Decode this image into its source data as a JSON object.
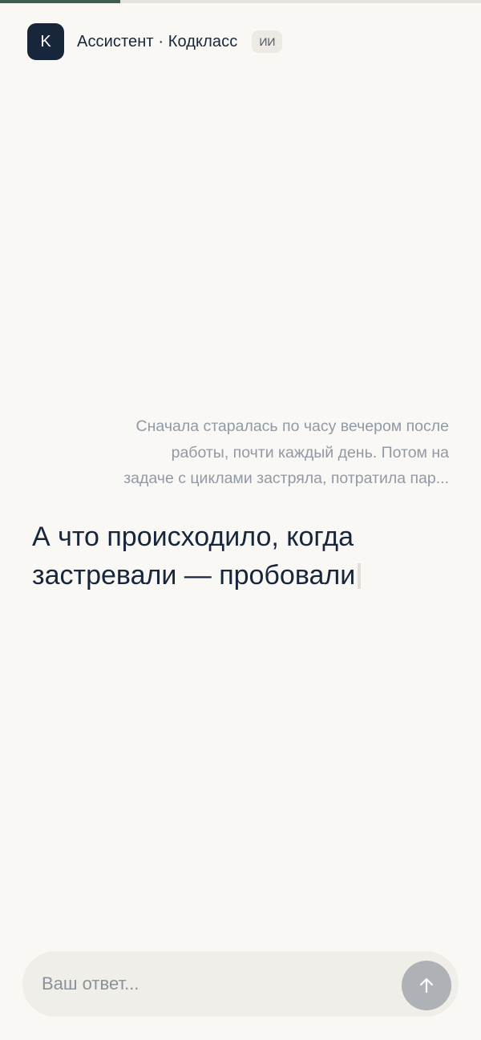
{
  "progress": {
    "value": 0.25,
    "color": "#3d5f4c"
  },
  "header": {
    "logo_letter": "K",
    "title": "Ассистент · Кодкласс",
    "badge": "ИИ"
  },
  "chat": {
    "user_message": {
      "lines": [
        "Сначала старалась по часу вечером после",
        "работы, почти каждый день. Потом на",
        "задаче с циклами застряла, потратила пар..."
      ]
    },
    "assistant_message": {
      "text": "А что происходило, когда застревали — пробовали"
    }
  },
  "composer": {
    "placeholder": "Ваш ответ...",
    "value": "",
    "send_icon": "arrow-up-icon"
  }
}
